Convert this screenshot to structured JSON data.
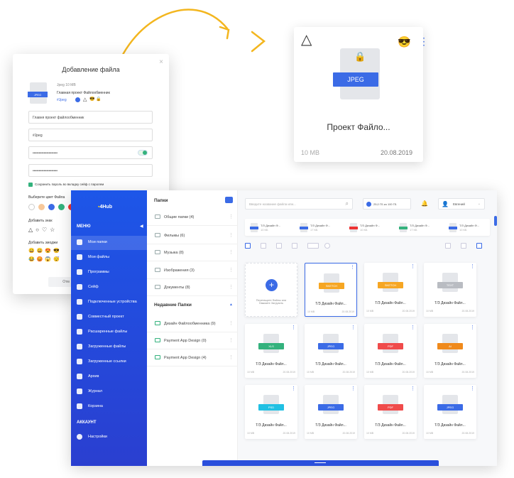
{
  "dialog": {
    "title": "Добавление файла",
    "close": "×",
    "file_size": "Jpeg 10 MB",
    "file_type_badge": "JPEG",
    "file_name": "Главная проект Файлообменник",
    "tag": "#Jpeg",
    "field_name": "Главня проект файлообменник",
    "field_tag": "#Jpeg",
    "field_password": "••••••••••••••••••••",
    "field_password_confirm": "••••••••••••••••••••",
    "save_password": "Сохранить пароль во вкладку сейф с паролем",
    "choose_color": "Выберите цвет Файла",
    "add_sign": "Добавить знак",
    "add_emoji": "Добавить эмоджи",
    "cancel": "Отм",
    "colors": [
      "#fff",
      "#f7c89a",
      "#3b6be6",
      "#34b27d",
      "#e33"
    ]
  },
  "big_card": {
    "badge": "JPEG",
    "name": "Проект Файло...",
    "size": "10 MB",
    "date": "20.08.2019",
    "emoji": "😎",
    "menu": "⋮"
  },
  "app": {
    "logo": "4Hub",
    "menu_header": "МЕНЮ",
    "account_header": "АККАУНТ",
    "nav": [
      {
        "label": "Мои папки"
      },
      {
        "label": "Мои файлы"
      },
      {
        "label": "Программы"
      },
      {
        "label": "Сейф"
      },
      {
        "label": "Подключенные устройства"
      },
      {
        "label": "Совместный проект"
      },
      {
        "label": "Расшаренные файлы"
      },
      {
        "label": "Загруженные файлы"
      },
      {
        "label": "Загруженные ссылки"
      },
      {
        "label": "Архив"
      },
      {
        "label": "Журнал"
      },
      {
        "label": "Корзина"
      }
    ],
    "settings": "Настройки",
    "folders_title": "Папки",
    "folders": [
      {
        "label": "Общие папки (4)"
      },
      {
        "label": "Фильмы (6)"
      },
      {
        "label": "Музыка (8)"
      },
      {
        "label": "Изображения (3)"
      },
      {
        "label": "Документы (8)"
      }
    ],
    "recent_title": "Недавние Папки",
    "recent": [
      {
        "label": "Дизайн Файлообменника (9)"
      },
      {
        "label": "Payment App Design (0)"
      },
      {
        "label": "Payment App Design (4)"
      }
    ],
    "search_placeholder": "Введите название файла или...",
    "storage": "25,0 ГБ из 100 ГБ",
    "user": "Евгений",
    "recent_files": [
      {
        "name": "Т/З Дизайн Ф...",
        "size": "10 КБ",
        "color": "#3b6be6"
      },
      {
        "name": "Т/З Дизайн Ф...",
        "size": "17 КБ",
        "color": "#3b6be6"
      },
      {
        "name": "Т/З Дизайн Ф...",
        "size": "10 КБ",
        "color": "#e33"
      },
      {
        "name": "Т/З Дизайн Ф...",
        "size": "17 КБ",
        "color": "#34b27d"
      },
      {
        "name": "Т/З Дизайн Ф...",
        "size": "10 КБ",
        "color": "#3b6be6"
      }
    ],
    "upload_tile": "Перетащите Файлы или Нажмите Загрузить",
    "files": [
      {
        "badge": "SKETCH",
        "color": "#f6a623",
        "name": "Т/З Дизайн Файл...",
        "size": "10 MB",
        "date": "20.08.2019"
      },
      {
        "badge": "SKETCH",
        "color": "#f6a623",
        "name": "Т/З Дизайн Файл...",
        "size": "10 MB",
        "date": "20.08.2019"
      },
      {
        "badge": "TEXT",
        "color": "#b9bcc2",
        "name": "Т/З Дизайн Файл...",
        "size": "10 MB",
        "date": "20.08.2019"
      },
      {
        "badge": "XLS",
        "color": "#34b27d",
        "name": "Т/З Дизайн Файл...",
        "size": "10 MB",
        "date": "20.08.2019"
      },
      {
        "badge": "JPEG",
        "color": "#3b6be6",
        "name": "Т/З Дизайн Файл...",
        "size": "10 MB",
        "date": "20.08.2019"
      },
      {
        "badge": "PDF",
        "color": "#f04b4b",
        "name": "Т/З Дизайн Файл...",
        "size": "10 MB",
        "date": "20.08.2019"
      },
      {
        "badge": "AI",
        "color": "#f08a1c",
        "name": "Т/З Дизайн Файл...",
        "size": "10 MB",
        "date": "20.08.2019"
      },
      {
        "badge": "PSD",
        "color": "#21c0e3",
        "name": "Т/З Дизайн Файл...",
        "size": "10 MB",
        "date": "20.08.2019"
      },
      {
        "badge": "JPEG",
        "color": "#3b6be6",
        "name": "Т/З Дизайн Файл...",
        "size": "10 MB",
        "date": "20.08.2019"
      },
      {
        "badge": "PDF",
        "color": "#f04b4b",
        "name": "Т/З Дизайн Файл...",
        "size": "10 MB",
        "date": "20.08.2019"
      },
      {
        "badge": "JPEG",
        "color": "#3b6be6",
        "name": "Т/З Дизайн Файл...",
        "size": "10 MB",
        "date": "20.08.2019"
      }
    ]
  }
}
